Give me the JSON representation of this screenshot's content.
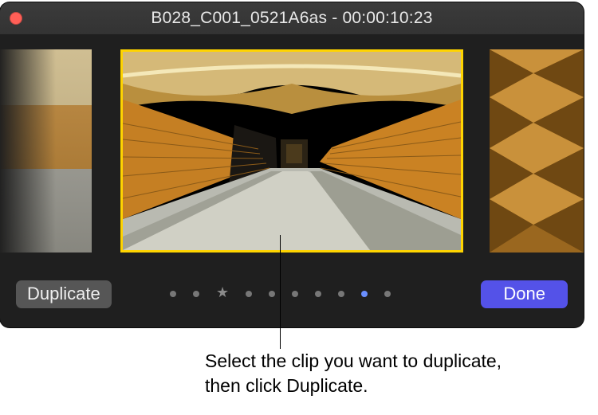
{
  "titlebar": {
    "title": "B028_C001_0521A6as - 00:00:10:23"
  },
  "toolbar": {
    "duplicate_label": "Duplicate",
    "done_label": "Done"
  },
  "pagination": {
    "total_markers": 10,
    "star_index": 2,
    "active_index": 8
  },
  "callout": {
    "text": "Select the clip you want to duplicate, then click Duplicate."
  },
  "colors": {
    "selection": "#ffd400",
    "primary_button": "#5452e8",
    "active_dot": "#6a8fff"
  }
}
